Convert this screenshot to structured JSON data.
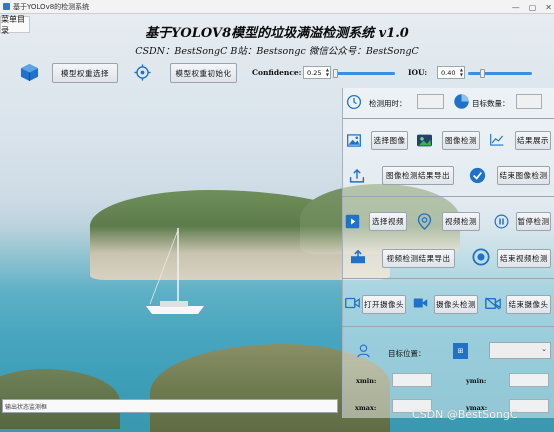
{
  "window": {
    "title": "基于YOLOv8的检测系统",
    "controls": [
      "—",
      "▢",
      "✕"
    ]
  },
  "menu": {
    "label": "菜单目录"
  },
  "header": {
    "title": "基于YOLOV8模型的垃圾满溢检测系统 v1.0",
    "subtitle": "CSDN：BestSongC   B站：Bestsongc   微信公众号：BestSongC"
  },
  "toolbar": {
    "select_weights_label": "模型权重选择",
    "init_weights_label": "模型权重初始化",
    "confidence_label": "Confidence:",
    "confidence_value": "0.25",
    "confidence_level": 0.25,
    "iou_label": "IOU:",
    "iou_value": "0.40",
    "iou_level": 0.4
  },
  "panel": {
    "detect_time_label": "检测用时：",
    "detect_time_value": "",
    "target_count_label": "目标数量：",
    "target_count_value": "",
    "select_image_label": "选择图像",
    "image_detect_label": "图像检测",
    "result_show_label": "结果展示",
    "image_export_label": "图像检测结果导出",
    "end_image_label": "结束图像检测",
    "select_video_label": "选择视频",
    "video_detect_label": "视频检测",
    "pause_label": "暂停检测",
    "video_export_label": "视频检测结果导出",
    "end_video_label": "结束视频检测",
    "open_camera_label": "打开摄像头",
    "camera_detect_label": "摄像头检测",
    "end_camera_label": "结束摄像头",
    "target_pos_label": "目标位置：",
    "target_select_value": "",
    "xmin_label": "xmin:",
    "ymin_label": "ymin:",
    "xmax_label": "xmax:",
    "ymax_label": "ymax:",
    "xmin_value": "",
    "ymin_value": "",
    "xmax_value": "",
    "ymax_value": ""
  },
  "status": {
    "text": "输出状态监测框"
  },
  "watermark": "CSDN @BestSongC",
  "colors": {
    "accent": "#1f72c8",
    "slider": "#3a90e0",
    "title_text": "#0b0b0b"
  }
}
